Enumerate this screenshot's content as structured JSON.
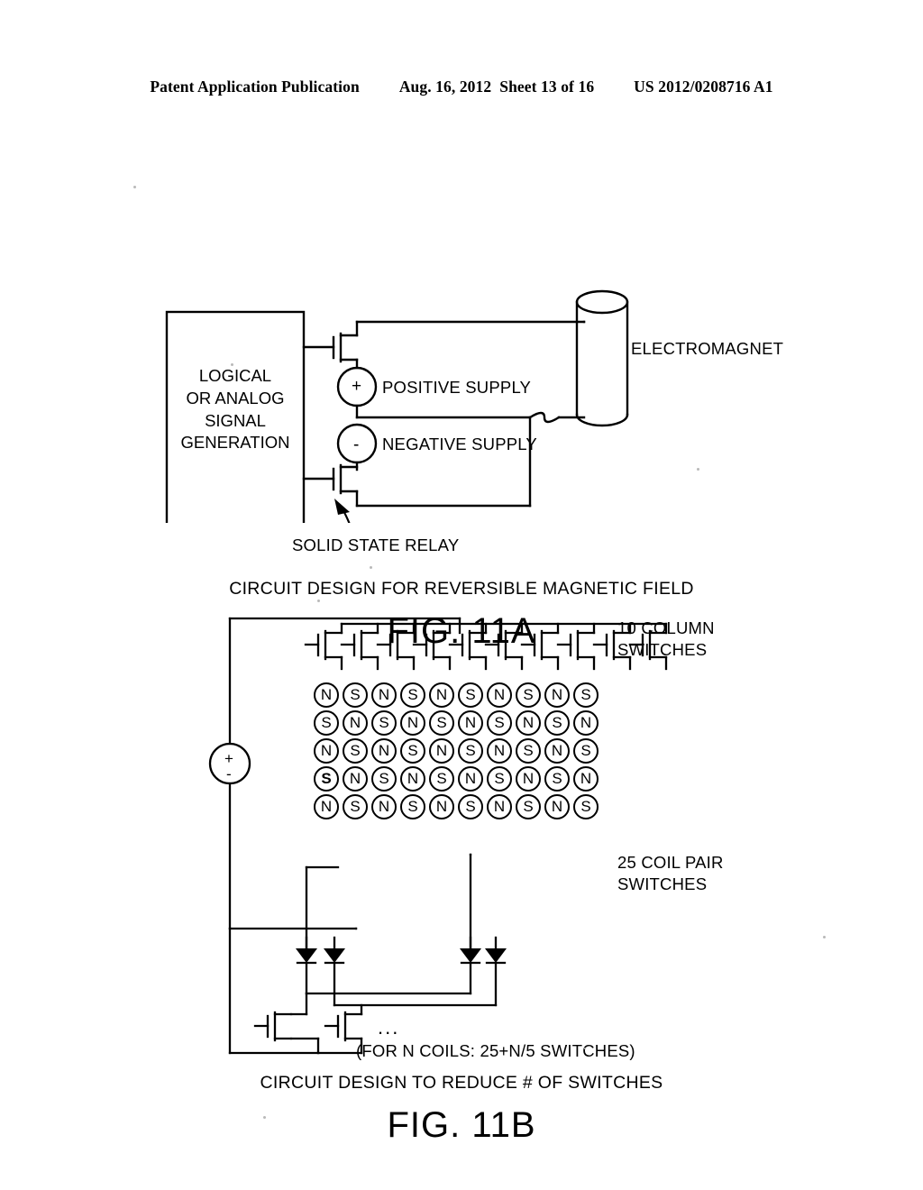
{
  "header": {
    "publication": "Patent Application Publication",
    "date": "Aug. 16, 2012",
    "sheet": "Sheet 13 of 16",
    "number": "US 2012/0208716 A1"
  },
  "figures": [
    {
      "id": "11A",
      "title": "FIG. 11A",
      "caption": "CIRCUIT DESIGN FOR REVERSIBLE MAGNETIC FIELD",
      "blocks": [
        {
          "name": "signal-generation-block",
          "lines": [
            "LOGICAL",
            "OR ANALOG",
            "SIGNAL",
            "GENERATION"
          ]
        }
      ],
      "labels": [
        {
          "name": "positive-supply-label",
          "text": "POSITIVE SUPPLY"
        },
        {
          "name": "negative-supply-label",
          "text": "NEGATIVE SUPPLY"
        },
        {
          "name": "electromagnet-label",
          "text": "ELECTROMAGNET"
        },
        {
          "name": "solid-state-relay-label",
          "text": "SOLID STATE RELAY"
        }
      ],
      "source_signs": {
        "positive": "+",
        "negative": "-"
      }
    },
    {
      "id": "11B",
      "title": "FIG. 11B",
      "caption": "CIRCUIT DESIGN TO REDUCE # OF SWITCHES",
      "labels": [
        {
          "name": "column-switches-label",
          "lines": [
            "10 COLUMN",
            "SWITCHES"
          ]
        },
        {
          "name": "coil-pair-switches-label",
          "lines": [
            "25 COIL PAIR",
            "SWITCHES"
          ]
        },
        {
          "name": "switch-count-note",
          "text": "(FOR N COILS: 25+N/5 SWITCHES)"
        },
        {
          "name": "ellipsis-label",
          "text": "..."
        }
      ],
      "source_signs": {
        "positive": "+",
        "negative": "-"
      },
      "column_switch_count": 10,
      "coil_grid": {
        "rows": 5,
        "cols": 10,
        "cells": [
          [
            "N",
            "S",
            "N",
            "S",
            "N",
            "S",
            "N",
            "S",
            "N",
            "S"
          ],
          [
            "S",
            "N",
            "S",
            "N",
            "S",
            "N",
            "S",
            "N",
            "S",
            "N"
          ],
          [
            "N",
            "S",
            "N",
            "S",
            "N",
            "S",
            "N",
            "S",
            "N",
            "S"
          ],
          [
            "S",
            "N",
            "S",
            "N",
            "S",
            "N",
            "S",
            "N",
            "S",
            "N"
          ],
          [
            "N",
            "S",
            "N",
            "S",
            "N",
            "S",
            "N",
            "S",
            "N",
            "S"
          ]
        ],
        "emphasized": [
          {
            "row": 3,
            "col": 0
          }
        ]
      },
      "diode_count": 4,
      "bottom_switch_count": 2
    }
  ],
  "colors": {
    "ink": "#000000",
    "page": "#ffffff"
  }
}
